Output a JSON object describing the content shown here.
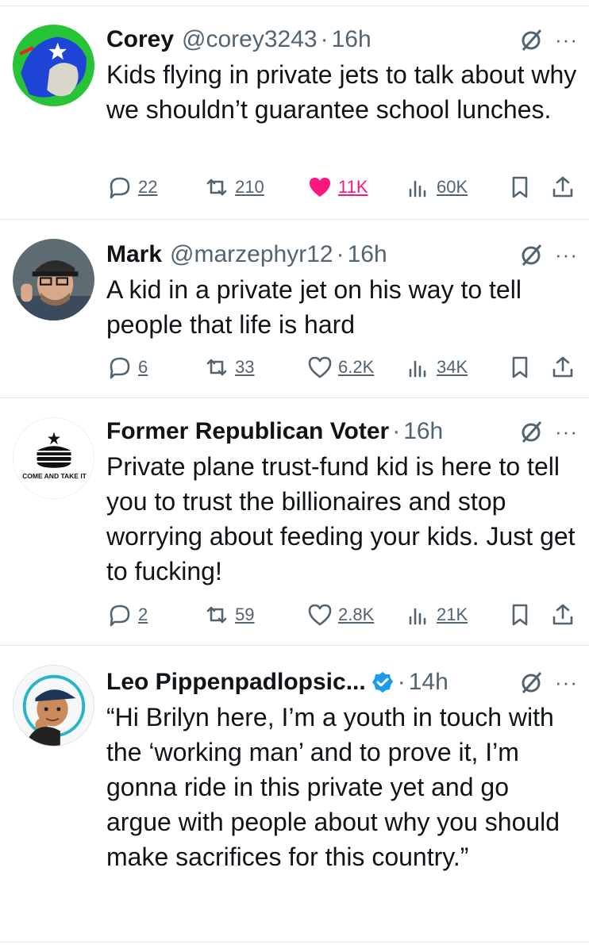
{
  "tweets": [
    {
      "name": "Corey",
      "handle": "@corey3243",
      "time": "16h",
      "text": "Kids flying in private jets to talk about why we shouldn’t guarantee school lunches.",
      "replies": "22",
      "retweets": "210",
      "likes": "11K",
      "views": "60K",
      "liked": true
    },
    {
      "name": "Mark",
      "handle": "@marzephyr12",
      "time": "16h",
      "text": "A kid in a private jet on his way to tell people that life is hard",
      "replies": "6",
      "retweets": "33",
      "likes": "6.2K",
      "views": "34K",
      "liked": false
    },
    {
      "name": "Former Republican Voter",
      "handle": "",
      "time": "16h",
      "text": "Private plane trust-fund kid is here to tell you to trust the billionaires and stop worrying about feeding your kids. Just get to fucking!",
      "replies": "2",
      "retweets": "59",
      "likes": "2.8K",
      "views": "21K",
      "liked": false,
      "avatar_text": "COME AND TAKE IT"
    },
    {
      "name": "Leo Pippenpadlopsic...",
      "handle": "",
      "time": "14h",
      "text": "“Hi Brilyn here, I’m a youth in touch with the ‘working man’ and to prove it, I’m gonna ride in this private yet and go argue with people about why you should make sacrifices for this country.”",
      "verified": true
    }
  ],
  "separator": "·",
  "more_glyph": "···",
  "colors": {
    "like_active": "#f91880",
    "verified": "#1d9bf0",
    "muted": "#536471"
  }
}
